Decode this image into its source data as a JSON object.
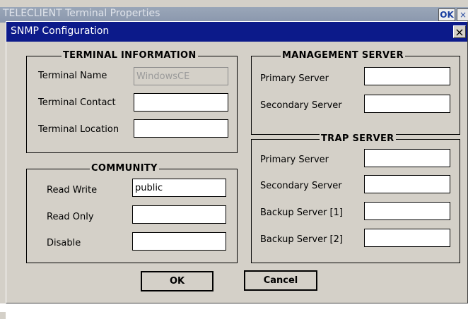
{
  "background_window": {
    "title": "TELECLIENT Terminal Properties",
    "ok_label": "OK",
    "close_glyph": "×"
  },
  "dialog": {
    "title": "SNMP Configuration",
    "close_glyph": "×"
  },
  "terminal_information": {
    "title": "TERMINAL INFORMATION",
    "name_label": "Terminal Name",
    "name_value": "WindowsCE",
    "contact_label": "Terminal Contact",
    "contact_value": "",
    "location_label": "Terminal Location",
    "location_value": ""
  },
  "community": {
    "title": "COMMUNITY",
    "read_write_label": "Read Write",
    "read_write_value": "public",
    "read_only_label": "Read Only",
    "read_only_value": "",
    "disable_label": "Disable",
    "disable_value": ""
  },
  "management_server": {
    "title": "MANAGEMENT SERVER",
    "primary_label": "Primary Server",
    "primary_value": "",
    "secondary_label": "Secondary Server",
    "secondary_value": ""
  },
  "trap_server": {
    "title": "TRAP SERVER",
    "primary_label": "Primary Server",
    "primary_value": "",
    "secondary_label": "Secondary Server",
    "secondary_value": "",
    "backup1_label": "Backup Server [1]",
    "backup1_value": "",
    "backup2_label": "Backup Server [2]",
    "backup2_value": ""
  },
  "buttons": {
    "ok_label": "OK",
    "cancel_label": "Cancel"
  }
}
